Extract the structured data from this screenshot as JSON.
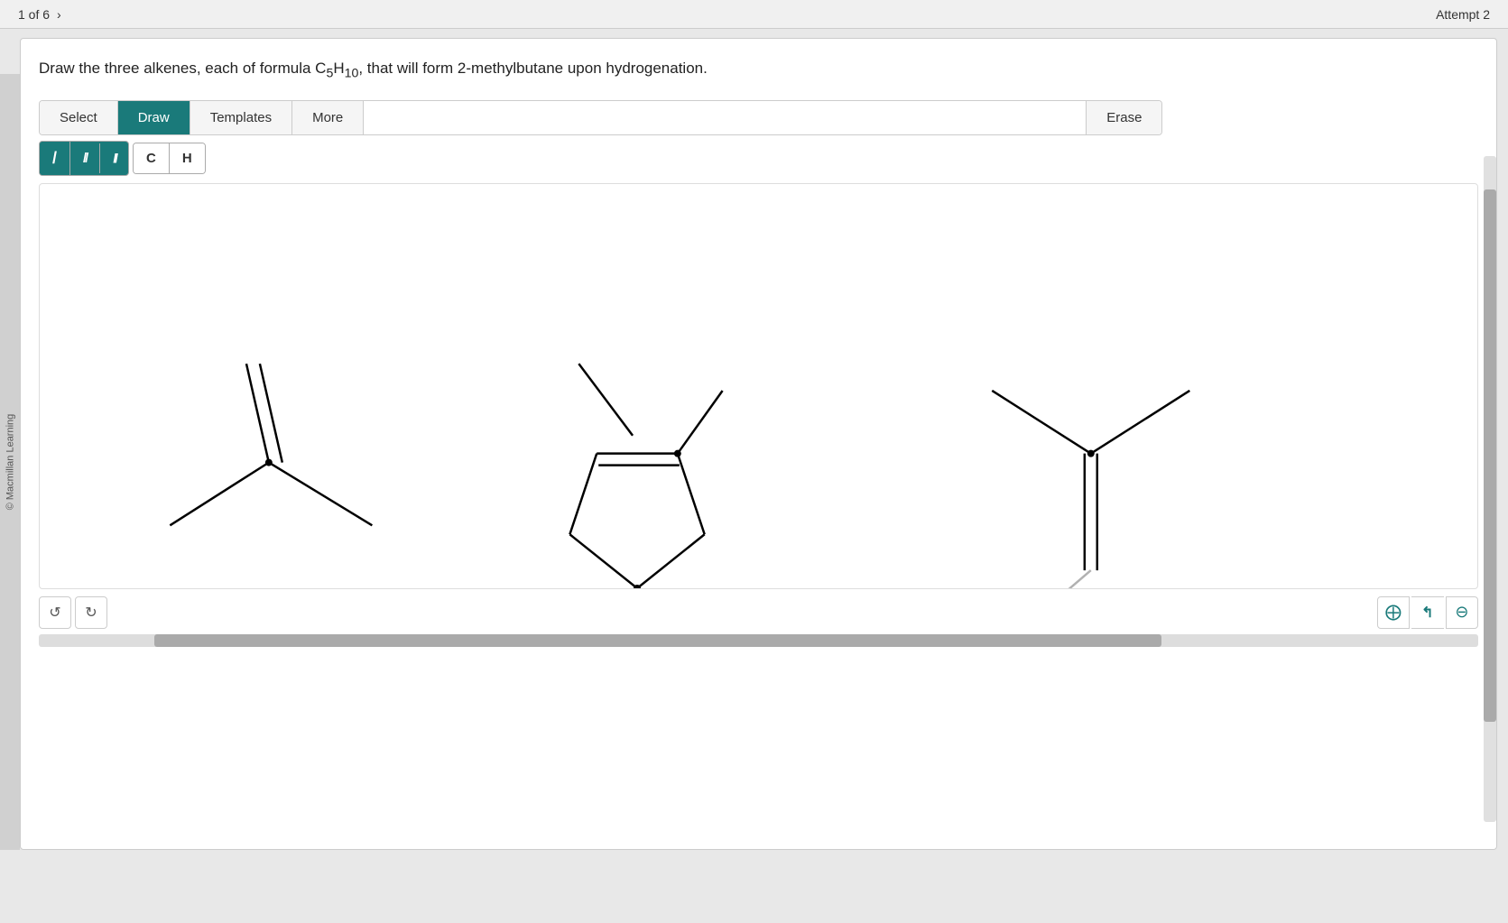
{
  "topbar": {
    "progress": "1 of 6",
    "attempt": "Attempt 2"
  },
  "sidelabel": "© Macmillan Learning",
  "question": {
    "text": "Draw the three alkenes, each of formula C",
    "sub5": "5",
    "sub10": "10",
    "text2": ", that will form 2-methylbutane upon hydrogenation."
  },
  "toolbar": {
    "select_label": "Select",
    "draw_label": "Draw",
    "templates_label": "Templates",
    "more_label": "More",
    "erase_label": "Erase"
  },
  "draw_tools": {
    "single_bond": "/",
    "double_bond": "//",
    "triple_bond": "///",
    "carbon_label": "C",
    "hydrogen_label": "H"
  },
  "bottom_controls": {
    "undo_icon": "↺",
    "redo_icon": "↻",
    "zoom_in_icon": "⊕",
    "zoom_fit_icon": "⤢",
    "zoom_out_icon": "⊖"
  }
}
